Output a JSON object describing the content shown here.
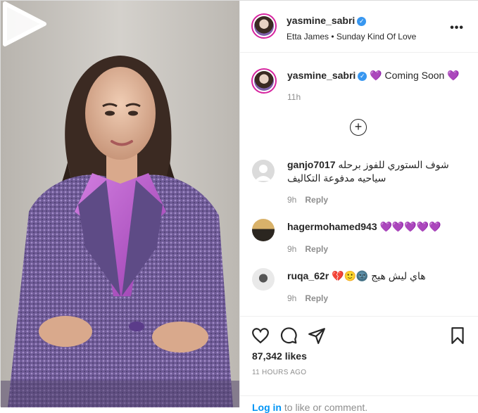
{
  "post": {
    "username": "yasmine_sabri",
    "audio": "Etta James • Sunday Kind Of Love",
    "more_icon": "more-options-icon"
  },
  "caption": {
    "username": "yasmine_sabri",
    "text": "Coming Soon",
    "heart_emoji": "💜",
    "time": "11h"
  },
  "comments": [
    {
      "username": "ganjo7017",
      "text": "شوف الستوري للفوز برحله سياحيه مدفوعة التكاليف",
      "time": "9h",
      "reply_label": "Reply"
    },
    {
      "username": "hagermohamed943",
      "text": "💜💜💜💜💜",
      "time": "9h",
      "reply_label": "Reply"
    },
    {
      "username": "ruqa_62r",
      "text": "هاي ليش هيج 🌚🙂💔",
      "time": "9h",
      "reply_label": "Reply"
    }
  ],
  "actions": {
    "likes_count": "87,342",
    "likes_label": "likes",
    "posted_ago": "11 HOURS AGO"
  },
  "login": {
    "link": "Log in",
    "rest": " to like or comment."
  },
  "colors": {
    "verified": "#3897f0",
    "heart": "#8a5cd6",
    "link": "#0095f6",
    "muted": "#8e8e8e"
  }
}
